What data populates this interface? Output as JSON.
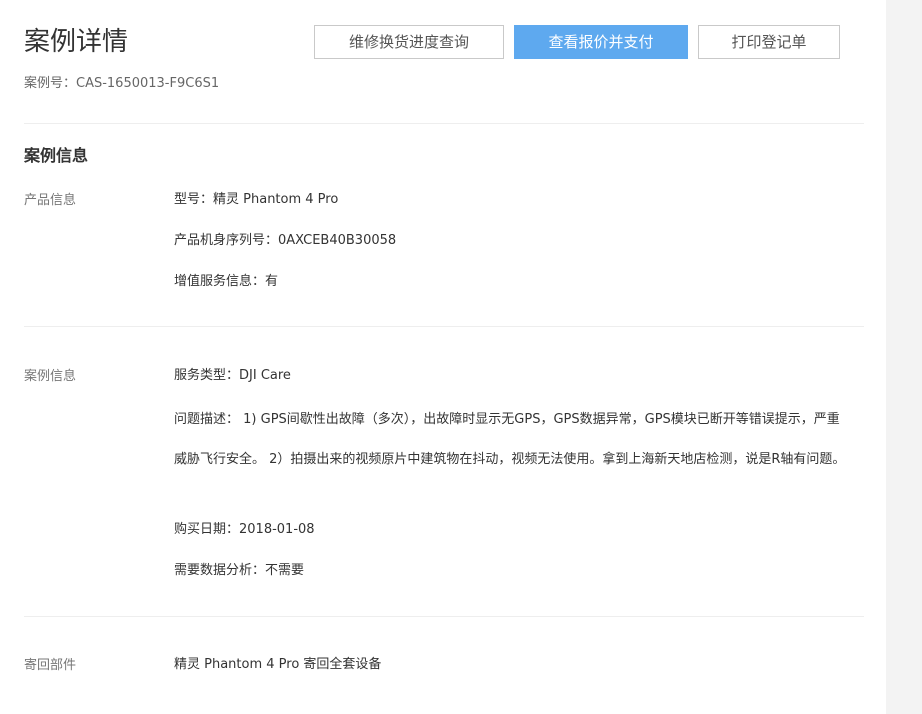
{
  "header": {
    "title": "案例详情",
    "case_number": "案例号：CAS-1650013-F9C6S1",
    "buttons": {
      "progress": "维修换货进度查询",
      "pay": "查看报价并支付",
      "print": "打印登记单"
    }
  },
  "section": {
    "title": "案例信息"
  },
  "product_info": {
    "label": "产品信息",
    "model_label": "型号：",
    "model_value": "精灵 Phantom 4 Pro",
    "serial_label": "产品机身序列号：",
    "serial_value": "0AXCEB40B30058",
    "vas_label": "增值服务信息：",
    "vas_value": "有"
  },
  "case_info": {
    "label": "案例信息",
    "service_type_label": "服务类型：",
    "service_type_value": "DJI Care",
    "problem_label": "问题描述：",
    "problem_value": "1) GPS间歇性出故障（多次），出故障时显示无GPS，GPS数据异常，GPS模块已断开等错误提示，严重威胁飞行安全。 2）拍摄出来的视频原片中建筑物在抖动，视频无法使用。拿到上海新天地店检测，说是R轴有问题。",
    "purchase_date_label": "购买日期：",
    "purchase_date_value": "2018-01-08",
    "data_analysis_label": "需要数据分析：",
    "data_analysis_value": "不需要"
  },
  "return_parts": {
    "label": "寄回部件",
    "value": "精灵 Phantom 4 Pro 寄回全套设备"
  }
}
